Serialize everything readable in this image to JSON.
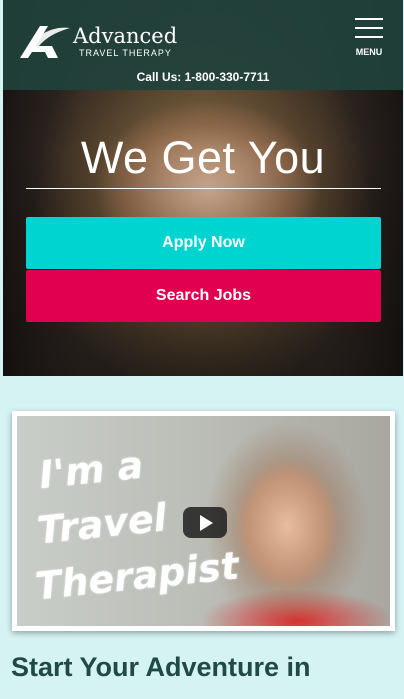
{
  "header": {
    "logo_name": "Advanced",
    "logo_sub": "TRAVEL THERAPY",
    "menu_label": "MENU",
    "call_text": "Call Us: 1-800-330-7711"
  },
  "hero": {
    "title": "We Get You",
    "apply_label": "Apply Now",
    "search_label": "Search Jobs"
  },
  "video": {
    "line1": "I'm a",
    "line2": "Travel",
    "line3": "Therapist"
  },
  "section": {
    "heading": "Start Your Adventure in"
  },
  "colors": {
    "header_bg": "#21423c",
    "apply": "#00d4d0",
    "search": "#e0004f",
    "section_bg": "#d6f3f4",
    "heading": "#1f4a45"
  }
}
